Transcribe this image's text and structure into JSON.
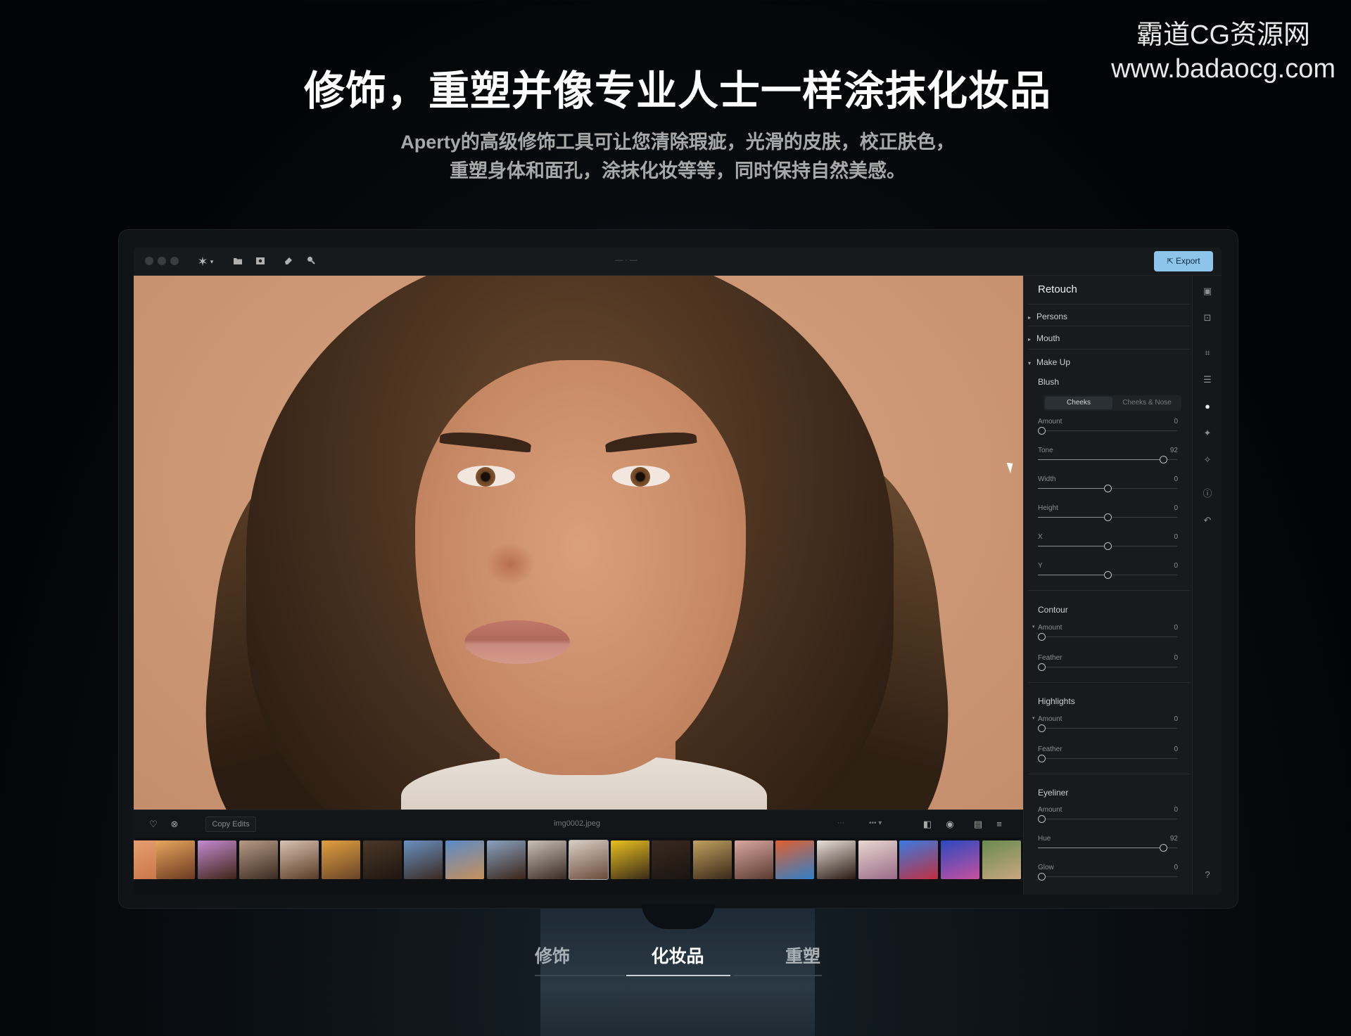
{
  "hero": {
    "headline": "修饰，重塑并像专业人士一样涂抹化妆品",
    "subline_1": "Aperty的高级修饰工具可让您清除瑕疵，光滑的皮肤，校正肤色，",
    "subline_2": "重塑身体和面孔，涂抹化妆等等，同时保持自然美感。"
  },
  "watermark": {
    "line_1": "霸道CG资源网",
    "line_2": "www.badaocg.com"
  },
  "app": {
    "toolbar": {
      "export_label": "Export"
    },
    "bottombar": {
      "copy_edits_label": "Copy Edits",
      "filename": "img0002.jpeg"
    },
    "panel": {
      "title": "Retouch",
      "sections": {
        "persons": "Persons",
        "mouth": "Mouth",
        "makeup": "Make Up"
      },
      "blush": {
        "title": "Blush",
        "seg_cheeks": "Cheeks",
        "seg_cheeks_nose": "Cheeks & Nose",
        "sliders": [
          {
            "label": "Amount",
            "value": "0",
            "pos": 0.0
          },
          {
            "label": "Tone",
            "value": "92",
            "pos": 0.92
          },
          {
            "label": "Width",
            "value": "0",
            "pos": 0.5
          },
          {
            "label": "Height",
            "value": "0",
            "pos": 0.5
          },
          {
            "label": "X",
            "value": "0",
            "pos": 0.5
          },
          {
            "label": "Y",
            "value": "0",
            "pos": 0.5
          }
        ]
      },
      "contour": {
        "title": "Contour",
        "sliders": [
          {
            "label": "Amount",
            "value": "0",
            "pos": 0.0
          },
          {
            "label": "Feather",
            "value": "0",
            "pos": 0.0
          }
        ]
      },
      "highlights": {
        "title": "Highlights",
        "sliders": [
          {
            "label": "Amount",
            "value": "0",
            "pos": 0.0
          },
          {
            "label": "Feather",
            "value": "0",
            "pos": 0.0
          }
        ]
      },
      "eyeliner": {
        "title": "Eyeliner",
        "sliders": [
          {
            "label": "Amount",
            "value": "0",
            "pos": 0.0
          },
          {
            "label": "Hue",
            "value": "92",
            "pos": 0.92
          },
          {
            "label": "Glow",
            "value": "0",
            "pos": 0.0
          }
        ]
      }
    }
  },
  "tabs": [
    {
      "label": "修饰",
      "active": false
    },
    {
      "label": "化妆品",
      "active": true
    },
    {
      "label": "重塑",
      "active": false
    }
  ],
  "colors": {
    "accent": "#8dc4ea",
    "backdrop": "#cf9a78"
  },
  "icons": {
    "toolbar": [
      "asterisk-icon",
      "folder-icon",
      "image-icon",
      "eraser-icon",
      "search-icon"
    ],
    "rail": [
      "layers-icon",
      "select-icon",
      "crop-icon",
      "adjust-icon",
      "person-icon",
      "body-icon",
      "sparkle-icon",
      "info-icon",
      "undo-icon",
      "help-icon"
    ]
  }
}
